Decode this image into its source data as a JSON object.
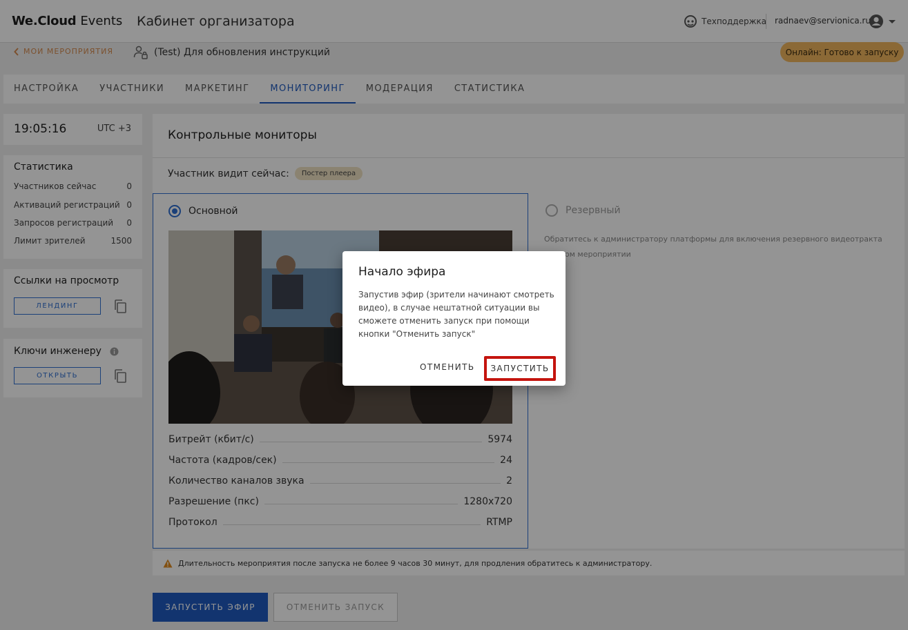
{
  "header": {
    "logo_brand": "We.Cloud",
    "logo_product": "Events",
    "title": "Кабинет организатора",
    "support_label": "Техподдержка",
    "user_email": "radnaev@servionica.ru"
  },
  "subheader": {
    "back_label": "МОИ МЕРОПРИЯТИЯ",
    "event_name": "(Test) Для обновления инструкций",
    "status": "Онлайн: Готово к запуску",
    "status_color": "#f0b65e"
  },
  "tabs": [
    {
      "label": "НАСТРОЙКА"
    },
    {
      "label": "УЧАСТНИКИ"
    },
    {
      "label": "МАРКЕТИНГ"
    },
    {
      "label": "МОНИТОРИНГ",
      "active": true
    },
    {
      "label": "МОДЕРАЦИЯ"
    },
    {
      "label": "СТАТИСТИКА"
    }
  ],
  "clock": {
    "time": "19:05:16",
    "timezone": "UTC +3"
  },
  "stats": {
    "title": "Статистика",
    "rows": [
      {
        "label": "Участников сейчас",
        "value": "0"
      },
      {
        "label": "Активаций регистраций",
        "value": "0"
      },
      {
        "label": "Запросов регистраций",
        "value": "0"
      },
      {
        "label": "Лимит зрителей",
        "value": "1500"
      }
    ]
  },
  "links": {
    "title": "Ссылки на просмотр",
    "button": "ЛЕНДИНГ"
  },
  "keys": {
    "title": "Ключи инженеру",
    "button": "ОТКРЫТЬ"
  },
  "main": {
    "title": "Контрольные мониторы",
    "viewer_label": "Участник видит сейчас:",
    "viewer_chip": "Постер плеера",
    "primary_label": "Основной",
    "reserve_label": "Резервный",
    "reserve_text": "Обратитесь к администратору платформы для включения резервного видеотракта на этом мероприятии",
    "metrics": [
      {
        "label": "Битрейт (кбит/с)",
        "value": "5974"
      },
      {
        "label": "Частота (кадров/сек)",
        "value": "24"
      },
      {
        "label": "Количество каналов звука",
        "value": "2"
      },
      {
        "label": "Разрешение (пкс)",
        "value": "1280x720"
      },
      {
        "label": "Протокол",
        "value": "RTMP"
      }
    ]
  },
  "warning": "Длительность мероприятия после запуска не более 9 часов 30 минут, для продления обратитесь к администратору.",
  "actions": {
    "start": "ЗАПУСТИТЬ ЭФИР",
    "cancel": "ОТМЕНИТЬ ЗАПУСК"
  },
  "modal": {
    "title": "Начало эфира",
    "text": "Запустив эфир (зрители начинают смотреть видео), в случае нештатной ситуации вы сможете отменить запуск при помощи кнопки \"Отменить запуск\"",
    "cancel": "ОТМЕНИТЬ",
    "confirm": "ЗАПУСТИТЬ",
    "highlight_color": "#c4140e"
  },
  "colors": {
    "accent": "#1f5bbf",
    "back_link": "#d68b4e"
  }
}
